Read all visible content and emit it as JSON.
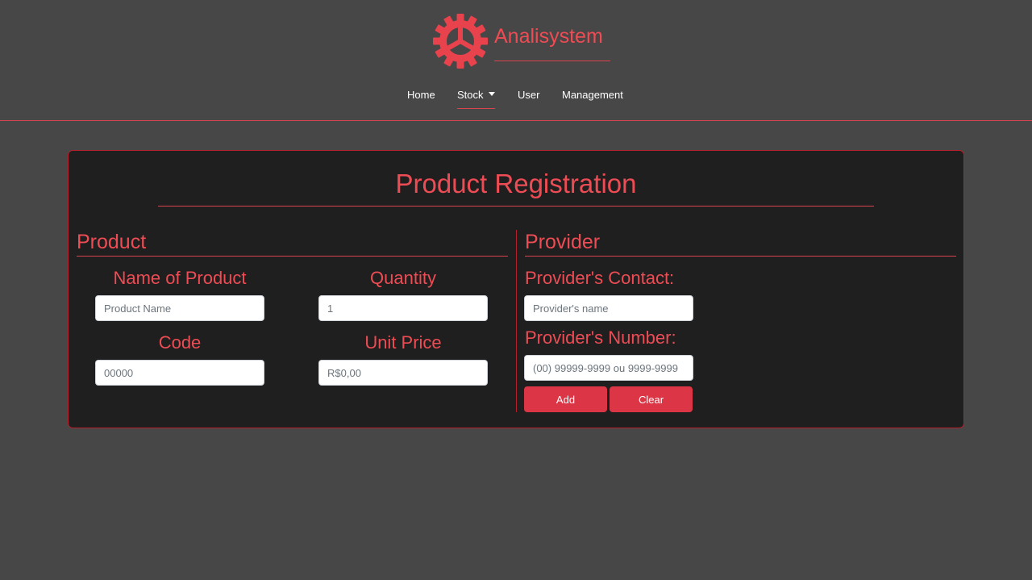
{
  "brand": {
    "name": "Analisystem",
    "logo_icon": "gear-icon",
    "color": "#ee4c54"
  },
  "nav": {
    "items": [
      {
        "label": "Home"
      },
      {
        "label": "Stock",
        "dropdown": true,
        "active": true
      },
      {
        "label": "User"
      },
      {
        "label": "Management"
      }
    ]
  },
  "form": {
    "title": "Product Registration",
    "product": {
      "heading": "Product",
      "name": {
        "label": "Name of Product",
        "placeholder": "Product Name",
        "value": ""
      },
      "quantity": {
        "label": "Quantity",
        "placeholder": "1",
        "value": ""
      },
      "code": {
        "label": "Code",
        "placeholder": "00000",
        "value": ""
      },
      "unit_price": {
        "label": "Unit Price",
        "placeholder": "R$0,00",
        "value": ""
      }
    },
    "provider": {
      "heading": "Provider",
      "contact": {
        "label": "Provider's Contact:",
        "placeholder": "Provider's name",
        "value": ""
      },
      "number": {
        "label": "Provider's Number:",
        "placeholder": "(00) 99999-9999 ou 9999-9999",
        "value": ""
      }
    },
    "buttons": {
      "add": "Add",
      "clear": "Clear"
    }
  },
  "colors": {
    "page_background": "#474747",
    "card_background": "#1f1f1f",
    "accent": "#ee4c54",
    "button": "#dc3545"
  }
}
